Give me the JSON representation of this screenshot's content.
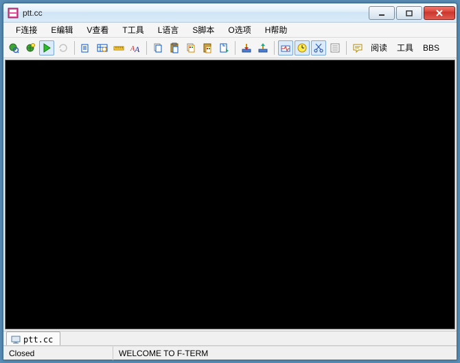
{
  "title": "ptt.cc",
  "menus": [
    "F连接",
    "E编辑",
    "V查看",
    "T工具",
    "L语言",
    "S脚本",
    "O选项",
    "H帮助"
  ],
  "toolbar_text_buttons": [
    "阅读",
    "工具",
    "BBS"
  ],
  "tab": {
    "label": "ptt.cc"
  },
  "status": {
    "state": "Closed",
    "message": "WELCOME TO F-TERM"
  }
}
